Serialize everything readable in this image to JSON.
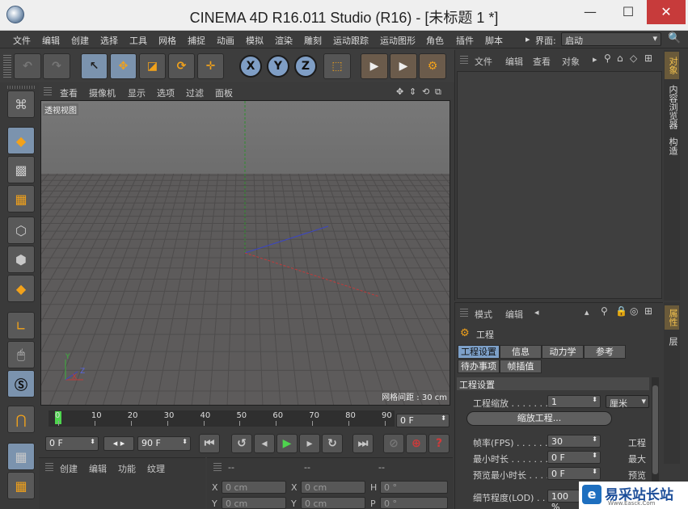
{
  "window": {
    "title": "CINEMA 4D R16.011 Studio (R16) - [未标题 1 *]",
    "minimize": "—",
    "maximize": "☐",
    "close": "✕"
  },
  "menubar": {
    "items": [
      "文件",
      "编辑",
      "创建",
      "选择",
      "工具",
      "网格",
      "捕捉",
      "动画",
      "模拟",
      "渲染",
      "雕刻",
      "运动跟踪",
      "运动图形",
      "角色",
      "插件",
      "脚本"
    ],
    "layout_label": "界面:",
    "layout_value": "启动"
  },
  "toolbar": {
    "axis_x": "X",
    "axis_y": "Y",
    "axis_z": "Z"
  },
  "viewport": {
    "menu": [
      "查看",
      "摄像机",
      "显示",
      "选项",
      "过滤",
      "面板"
    ],
    "view_name": "透视视图",
    "grid_spacing": "网格间距 : 30 cm",
    "axis_y": "Y",
    "axis_x": "X",
    "axis_z": "Z"
  },
  "timeline": {
    "ticks": [
      "0",
      "10",
      "20",
      "30",
      "40",
      "50",
      "60",
      "70",
      "80",
      "90"
    ],
    "current_frame": "0 F",
    "start_frame": "0 F",
    "end_frame": "90 F",
    "playhead_fraction": 0.0
  },
  "objects_panel": {
    "menu": [
      "文件",
      "编辑",
      "查看",
      "对象"
    ],
    "side_tabs": [
      "对象",
      "内容浏览器",
      "构造"
    ]
  },
  "attributes_panel": {
    "menu": [
      "模式",
      "编辑"
    ],
    "header": "工程",
    "tabs": [
      "工程设置",
      "信息",
      "动力学",
      "参考"
    ],
    "tabs2": [
      "待办事项",
      "帧插值"
    ],
    "section": "工程设置",
    "rows": [
      {
        "label": "工程缩放 . . . . . . .",
        "value": "1",
        "unit": "厘米"
      },
      {
        "label": "帧率(FPS) . . . . . .",
        "value": "30",
        "right": "工程"
      },
      {
        "label": "最小时长 . . . . . . . .",
        "value": "0 F",
        "right": "最大"
      },
      {
        "label": "预览最小时长 . . . .",
        "value": "0 F",
        "right": "预览"
      },
      {
        "label": "细节程度(LOD) . . .",
        "value": "100 %"
      }
    ],
    "scale_button": "缩放工程...",
    "side_tabs": [
      "属性",
      "层"
    ]
  },
  "material_panel": {
    "menu": [
      "创建",
      "编辑",
      "功能",
      "纹理"
    ]
  },
  "coordinates_panel": {
    "headers": [
      "--",
      "--",
      "--"
    ],
    "rows": [
      {
        "a": "X",
        "av": "0 cm",
        "b": "X",
        "bv": "0 cm",
        "c": "H",
        "cv": "0 °"
      },
      {
        "a": "Y",
        "av": "0 cm",
        "b": "Y",
        "bv": "0 cm",
        "c": "P",
        "cv": "0 °"
      }
    ]
  },
  "watermark": {
    "text": "易采站长站",
    "sub": "Www.Easck.Com"
  },
  "colors": {
    "accent_blue": "#7da0c8",
    "accent_orange": "#f2a21b",
    "play_green": "#4ed54e",
    "stop_red": "#d03a3a"
  }
}
